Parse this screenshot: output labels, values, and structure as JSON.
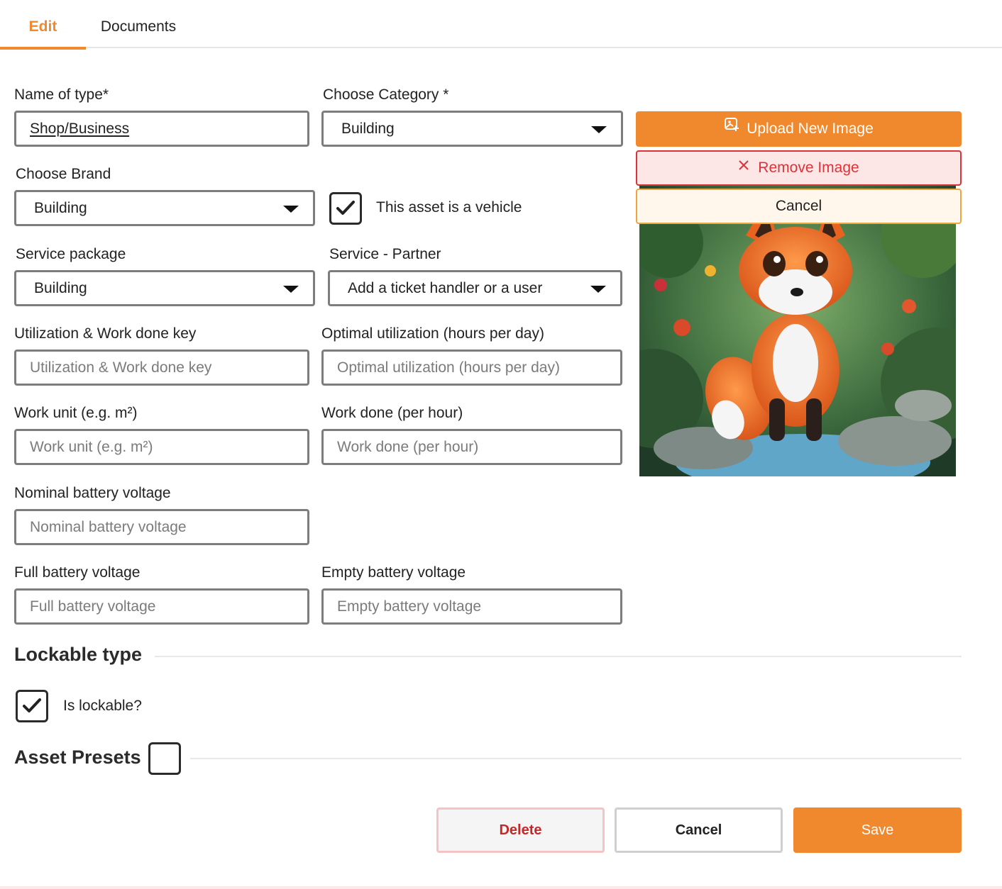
{
  "tabs": [
    {
      "label": "Edit",
      "active": true
    },
    {
      "label": "Documents",
      "active": false
    }
  ],
  "form": {
    "name_of_type": {
      "label": "Name of type*",
      "value": "Shop/Business"
    },
    "category": {
      "label": "Choose Category *",
      "value": "Building"
    },
    "brand": {
      "label": "Choose Brand",
      "value": "Building"
    },
    "vehicle": {
      "label": "This asset is a vehicle",
      "checked": true
    },
    "service_package": {
      "label": "Service package",
      "value": "Building"
    },
    "service_partner": {
      "label": "Service - Partner",
      "value": "Add a ticket handler or a user"
    },
    "utilization_key": {
      "label": "Utilization & Work done key",
      "placeholder": "Utilization & Work done key"
    },
    "optimal_utilization": {
      "label": "Optimal utilization (hours per day)",
      "placeholder": "Optimal utilization (hours per day)"
    },
    "work_unit": {
      "label": "Work unit (e.g. m²)",
      "placeholder": "Work unit (e.g. m²)"
    },
    "work_done": {
      "label": "Work done (per hour)",
      "placeholder": "Work done (per hour)"
    },
    "nominal_voltage": {
      "label": "Nominal battery voltage",
      "placeholder": "Nominal battery voltage"
    },
    "full_voltage": {
      "label": "Full battery voltage",
      "placeholder": "Full battery voltage"
    },
    "empty_voltage": {
      "label": "Empty battery voltage",
      "placeholder": "Empty battery voltage"
    }
  },
  "image_panel": {
    "upload_label": "Upload New Image",
    "upload_icon": "image-add-icon",
    "remove_label": "Remove Image",
    "remove_icon": "close-icon",
    "cancel_label": "Cancel"
  },
  "lockable": {
    "section_title": "Lockable type",
    "is_lockable_label": "Is lockable?",
    "is_lockable_checked": true
  },
  "presets": {
    "section_title": "Asset Presets",
    "checked": false
  },
  "footer": {
    "delete_label": "Delete",
    "cancel_label": "Cancel",
    "save_label": "Save"
  },
  "colors": {
    "accent": "#f0882d",
    "danger": "#d9343a",
    "border": "#7d7d7d"
  }
}
